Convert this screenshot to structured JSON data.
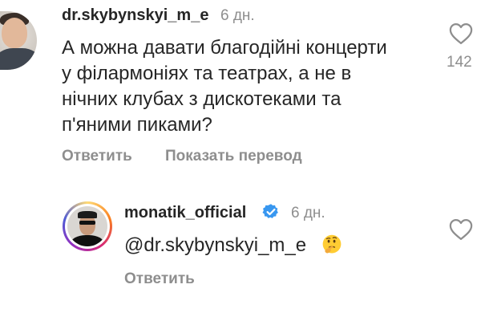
{
  "comment": {
    "username": "dr.skybynskyi_m_e",
    "time": "6 дн.",
    "text_lines": [
      "А можна давати благодійні концерти",
      "у філармоніях та театрах, а не в",
      "нічних клубах з дискотеками та",
      "п'яними пиками?"
    ],
    "reply_label": "Ответить",
    "translate_label": "Показать перевод",
    "like_count": "142"
  },
  "reply": {
    "username": "monatik_official",
    "time": "6 дн.",
    "mention": "@dr.skybynskyi_m_e",
    "emoji_name": "thinking-face-emoji",
    "reply_label": "Ответить"
  },
  "icons": {
    "like": "heart-outline-icon",
    "verified": "verified-badge-icon"
  },
  "colors": {
    "text": "#262626",
    "secondary": "#8e8e8e",
    "verified": "#3897f0"
  }
}
